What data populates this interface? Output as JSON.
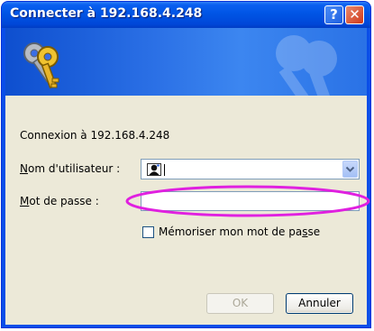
{
  "dialog": {
    "title_prefix": "Connecter à ",
    "title_host": "192.168.4.248",
    "help_label": "?",
    "close_label": "✕"
  },
  "form": {
    "connection_text": "Connexion à 192.168.4.248",
    "username_label_accel": "N",
    "username_label_rest": "om d'utilisateur :",
    "username_value": "",
    "password_label_accel": "M",
    "password_label_rest": "ot de passe :",
    "password_value": "",
    "remember_label_part1": "Mémoriser mon mot de pa",
    "remember_label_accel": "s",
    "remember_label_part2": "se",
    "remember_checked": false
  },
  "buttons": {
    "ok_label": "OK",
    "cancel_label": "Annuler",
    "ok_enabled": false
  },
  "colors": {
    "title_bar": "#0055e5",
    "banner": "#2a6fe5",
    "client_bg": "#ece9d8",
    "annotation": "#e020e0"
  },
  "icons": [
    "keys-icon",
    "user-card-icon",
    "chevron-down-icon",
    "help-icon",
    "close-icon"
  ]
}
